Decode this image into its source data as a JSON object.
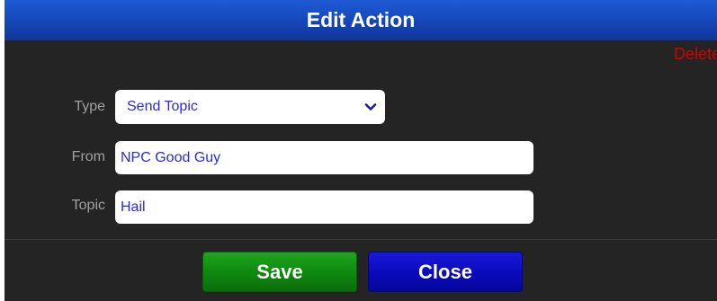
{
  "dialog": {
    "title": "Edit Action",
    "delete_label": "Delete"
  },
  "form": {
    "type": {
      "label": "Type",
      "value": "Send Topic",
      "icon": "chevron-down-icon"
    },
    "from": {
      "label": "From",
      "value": "NPC Good Guy"
    },
    "topic": {
      "label": "Topic",
      "value": "Hail"
    }
  },
  "buttons": {
    "save_label": "Save",
    "close_label": "Close"
  },
  "colors": {
    "title_bar": "#1446b8",
    "background": "#242424",
    "delete": "#d40000",
    "save": "#0f8a0f",
    "close": "#0b0bbf",
    "field_text": "#2a2ae0"
  }
}
